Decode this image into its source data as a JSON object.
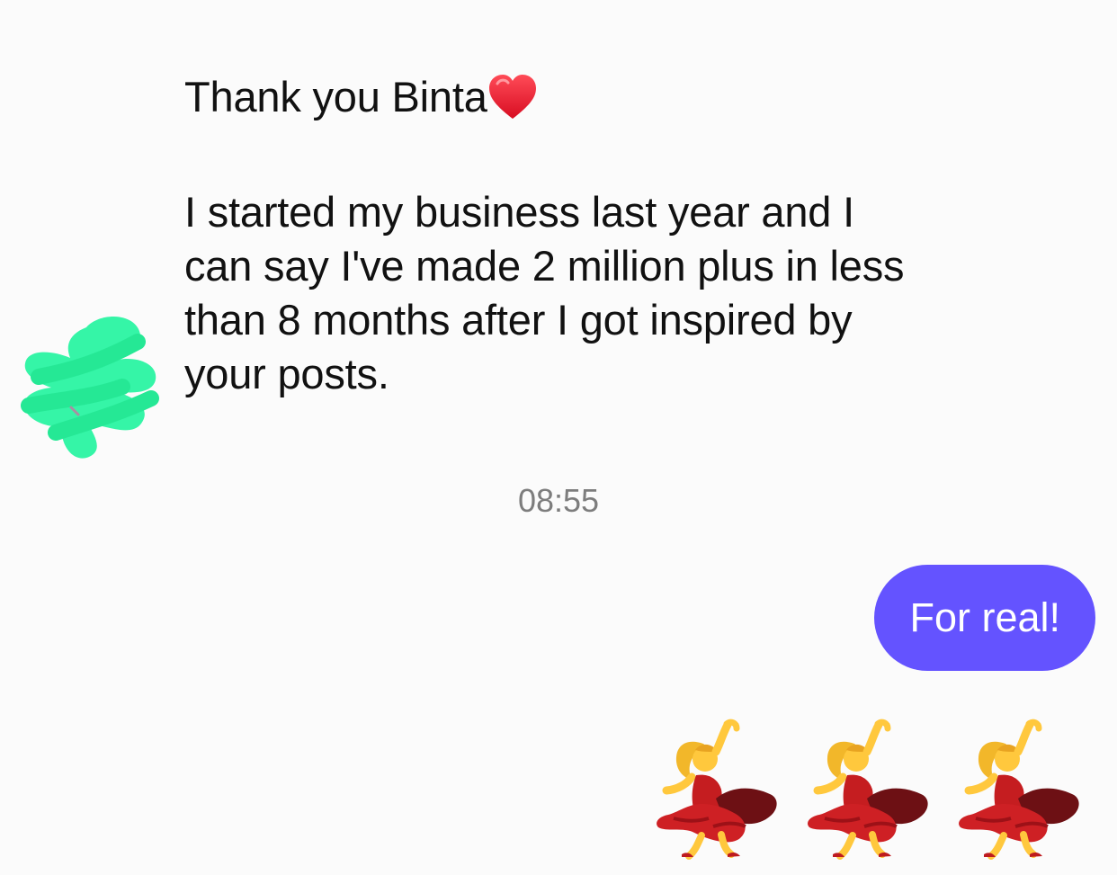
{
  "chat": {
    "incoming_message": {
      "lines": [
        "Thank you Binta",
        "I started my business last year and I",
        "can say I've made 2 million plus in less",
        "than 8 months after I got inspired by",
        "your posts."
      ],
      "emoji_icon": "red-heart-icon"
    },
    "timestamp": "08:55",
    "outgoing_messages": [
      {
        "text": "For real!",
        "bubble_color": "#6453ff"
      },
      {
        "emojis": [
          "dancing-woman-icon",
          "dancing-woman-icon",
          "dancing-woman-icon"
        ]
      }
    ]
  },
  "colors": {
    "background": "#fbfbfb",
    "text": "#111111",
    "timestamp": "#7d7d7d",
    "outgoing_text": "#ffffff",
    "redaction": "#35f5a7",
    "heart": "#e2212f"
  }
}
